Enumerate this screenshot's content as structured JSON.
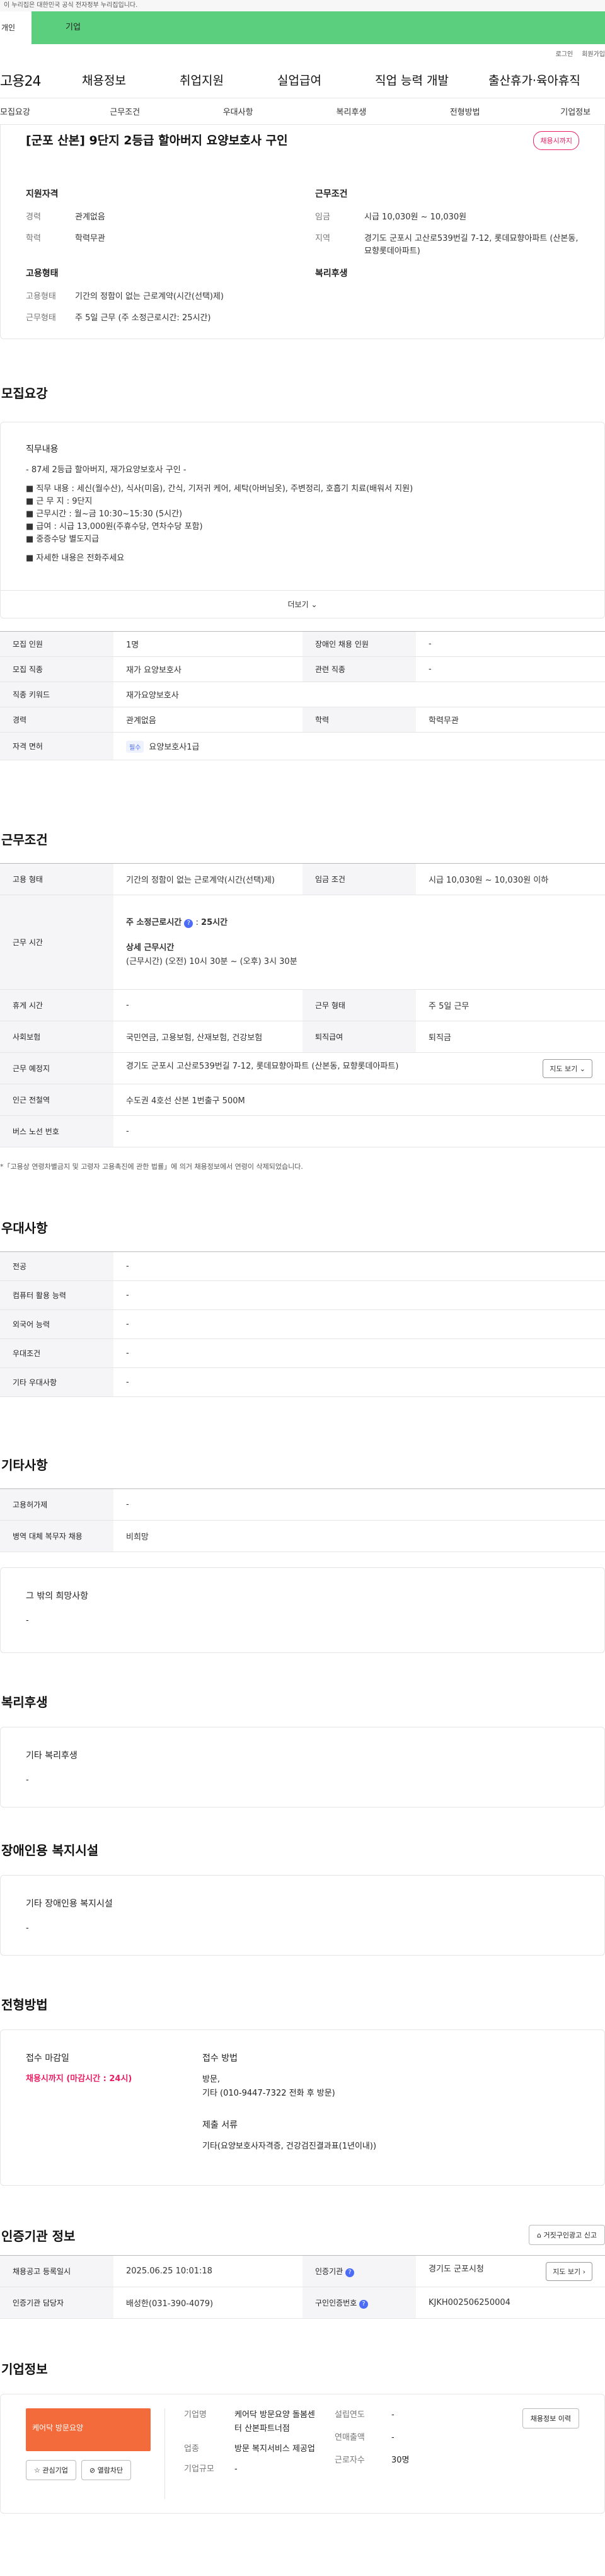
{
  "topbar": {
    "text": "이 누리집은 대한민국 공식 전자정부 누리집입니다."
  },
  "tabs": {
    "personal": "개인",
    "company": "기업"
  },
  "util": {
    "login": "로그인",
    "join": "회원가입"
  },
  "gnb": {
    "logo": "고용24",
    "items": [
      "채용정보",
      "취업지원",
      "실업급여",
      "직업 능력 개발",
      "출산휴가·육아휴직"
    ]
  },
  "subnav": [
    "모집요강",
    "근무조건",
    "우대사항",
    "복리후생",
    "전형방법",
    "기업정보"
  ],
  "job": {
    "title": "[군포 산본] 9단지 2등급 할아버지 요양보호사 구인",
    "status": "채용시까지",
    "qual_h": "지원자격",
    "cond_h": "근무조건",
    "type_h": "고용형태",
    "welfare_h": "복리후생",
    "career_k": "경력",
    "career_v": "관계없음",
    "edu_k": "학력",
    "edu_v": "학력무관",
    "wage_k": "임금",
    "wage_v": "시급 10,030원 ~ 10,030원",
    "loc_k": "지역",
    "loc_v": "경기도 군포시 고산로539번길 7-12, 롯데묘향아파트 (산본동, 묘향롯데아파트)",
    "emp_k": "고용형태",
    "emp_v": "기간의 정함이 없는 근로계약(시간(선택)제)",
    "form_k": "근무형태",
    "form_v": "주 5일 근무 (주 소정근로시간: 25시간)"
  },
  "recruit": {
    "title": "모집요강",
    "detail_h": "직무내용",
    "lines": [
      "- 87세 2등급 할아버지, 재가요양보호사 구인 -",
      "",
      "■ 직무 내용 : 세신(월수산), 식사(미음), 간식, 기저귀 케어, 세탁(아버님옷), 주변정리, 호흡기 치료(배워서 지원)",
      "■ 근 무 지 : 9단지",
      "■ 근무시간 : 월~금 10:30~15:30 (5시간)",
      "■ 급여 : 시급 13,000원(주휴수당, 연차수당 포함)",
      "■ 중증수당 별도지급",
      "",
      "■ 자세한 내용은 전화주세요"
    ],
    "more": "더보기",
    "rows": [
      {
        "k1": "모집 인원",
        "v1": "1명",
        "k2": "장애인 채용 인원",
        "v2": "-"
      },
      {
        "k1": "모집 직종",
        "v1": "재가 요양보호사",
        "k2": "관련 직종",
        "v2": "-"
      },
      {
        "k1": "직종 키워드",
        "v1": "재가요양보호사",
        "k2": "",
        "v2": ""
      },
      {
        "k1": "경력",
        "v1": "관계없음",
        "k2": "학력",
        "v2": "학력무관"
      }
    ],
    "license_k": "자격 면허",
    "license_tag": "필수",
    "license_v": "요양보호사1급"
  },
  "work": {
    "title": "근무조건",
    "emp_k": "고용 형태",
    "emp_v": "기간의 정함이 없는 근로계약(시간(선택)제)",
    "wage_k": "임금 조건",
    "wage_v": "시급 10,030원 ~ 10,030원 이하",
    "time_k": "근무 시간",
    "weekly_label": "주 소정근로시간",
    "weekly_v": "25시간",
    "detail_label": "상세 근무시간",
    "detail_v": "(근무시간) (오전) 10시 30분 ~ (오후) 3시 30분",
    "rest_k": "휴게 시간",
    "rest_v": "-",
    "form_k": "근무 형태",
    "form_v": "주 5일 근무",
    "ins_k": "사회보험",
    "ins_v": "국민연금, 고용보험, 산재보험, 건강보험",
    "sev_k": "퇴직급여",
    "sev_v": "퇴직금",
    "loc_k": "근무 예정지",
    "loc_v": "경기도 군포시 고산로539번길 7-12, 롯데묘향아파트 (산본동, 묘향롯데아파트)",
    "map": "지도 보기",
    "sub_k": "인근 전철역",
    "sub_v": "수도권 4호선 산본 1번출구 500M",
    "bus_k": "버스 노선 번호",
    "bus_v": "-",
    "note": "*「고용상 연령차별금지 및 고령자 고용촉진에 관한 법률」에 의거 채용정보에서 연령이 삭제되었습니다."
  },
  "pref": {
    "title": "우대사항",
    "rows": [
      {
        "k": "전공",
        "v": "-"
      },
      {
        "k": "컴퓨터 활용 능력",
        "v": "-"
      },
      {
        "k": "외국어 능력",
        "v": "-"
      },
      {
        "k": "우대조건",
        "v": "-"
      },
      {
        "k": "기타 우대사항",
        "v": "-"
      }
    ]
  },
  "etc": {
    "title": "기타사항",
    "rows": [
      {
        "k": "고용허가제",
        "v": "-"
      },
      {
        "k": "병역 대체 복무자 채용",
        "v": "비희망"
      }
    ],
    "box_h": "그 밖의 희망사항",
    "box_v": "-"
  },
  "welfare": {
    "title": "복리후생",
    "box_h": "기타 복리후생",
    "box_v": "-"
  },
  "disabled": {
    "title": "장애인용 복지시설",
    "box_h": "기타 장애인용 복지시설",
    "box_v": "-"
  },
  "selection": {
    "title": "전형방법",
    "deadline_h": "접수 마감일",
    "deadline_v": "채용시까지 (마감시간 : 24시)",
    "method_h": "접수 방법",
    "method_v1": "방문,",
    "method_v2": "기타 (010-9447-7322 전화 후 방문)",
    "docs_h": "제출 서류",
    "docs_v": "기타(요양보호사자격증, 건강검진결과표(1년이내))"
  },
  "cert": {
    "title": "인증기관 정보",
    "report": "거짓구인광고 신고",
    "reg_k": "채용공고 등록일시",
    "reg_v": "2025.06.25 10:01:18",
    "org_k": "인증기관",
    "org_v": "경기도 군포시청",
    "map": "지도 보기",
    "mgr_k": "인증기관 담당자",
    "mgr_v": "배성한(031-390-4079)",
    "no_k": "구인인증번호",
    "no_v": "KJKH002506250004"
  },
  "company": {
    "title": "기업정보",
    "logo_text": "케어닥 방문요양",
    "fav": "관심기업",
    "block": "열람차단",
    "name_k": "기업명",
    "name_v": "케어닥 방문요양 돌봄센터 산본파트너점",
    "ind_k": "업종",
    "ind_v": "방문 복지서비스 제공업",
    "size_k": "기업규모",
    "size_v": "-",
    "year_k": "설립연도",
    "year_v": "-",
    "sales_k": "연매출액",
    "sales_v": "-",
    "emp_k": "근로자수",
    "emp_v": "30명",
    "history": "채용정보 이력"
  }
}
